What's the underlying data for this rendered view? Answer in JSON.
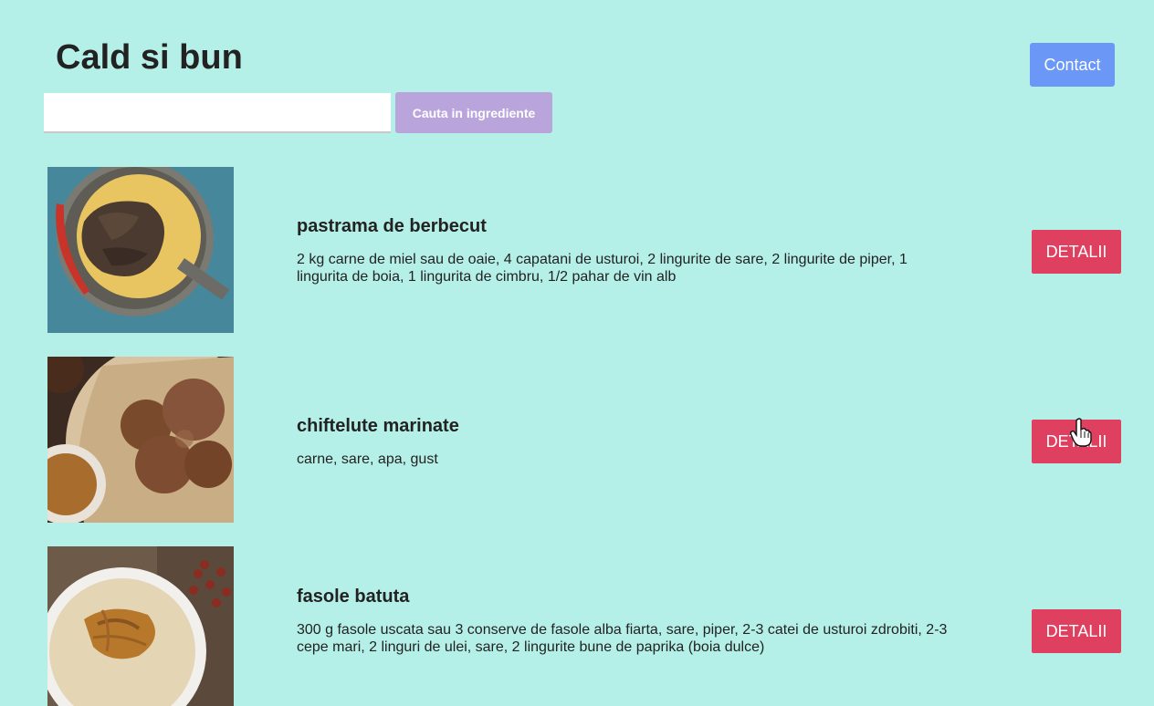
{
  "header": {
    "title": "Cald si bun",
    "contact_label": "Contact"
  },
  "search": {
    "value": "",
    "placeholder": "",
    "button_label": "Cauta in ingrediente"
  },
  "recipes": [
    {
      "name": "pastrama de berbecut",
      "ingredients": "2 kg carne de miel sau de oaie, 4 capatani de usturoi, 2 lingurite de sare, 2 lingurite de piper, 1 lingurita de boia, 1 lingurita de cimbru, 1/2 pahar de vin alb",
      "button_label": "DETALII"
    },
    {
      "name": "chiftelute marinate",
      "ingredients": "carne, sare, apa, gust",
      "button_label": "DETALII"
    },
    {
      "name": "fasole batuta",
      "ingredients": "300 g fasole uscata sau 3 conserve de fasole alba fiarta, sare, piper, 2-3 catei de usturoi zdrobiti, 2-3 cepe mari, 2 linguri de ulei, sare, 2 lingurite bune de paprika (boia dulce)",
      "button_label": "DETALII"
    }
  ],
  "colors": {
    "background": "#b5f0e8",
    "contact_button": "#6b97f7",
    "search_button": "#b9a5dc",
    "detail_button": "#e0405f"
  }
}
